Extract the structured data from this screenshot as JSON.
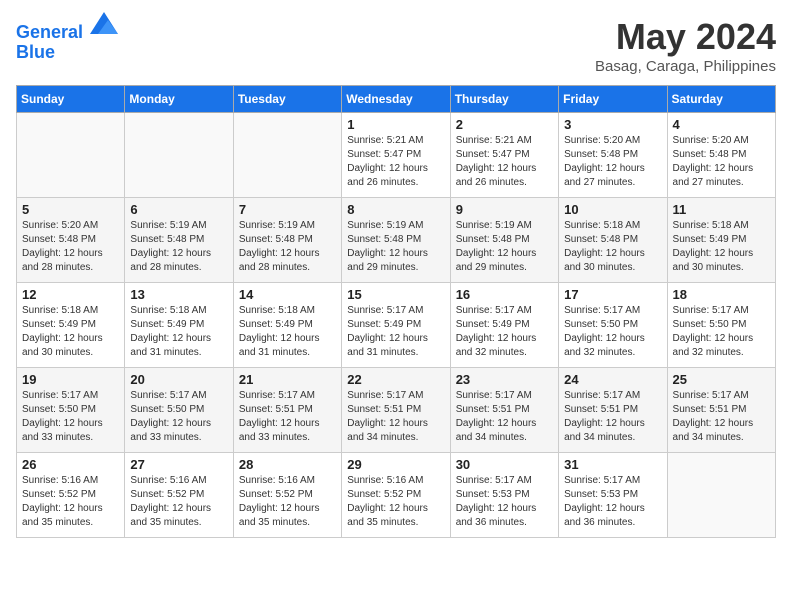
{
  "header": {
    "logo_line1": "General",
    "logo_line2": "Blue",
    "title": "May 2024",
    "subtitle": "Basag, Caraga, Philippines"
  },
  "weekdays": [
    "Sunday",
    "Monday",
    "Tuesday",
    "Wednesday",
    "Thursday",
    "Friday",
    "Saturday"
  ],
  "weeks": [
    [
      {
        "day": "",
        "info": ""
      },
      {
        "day": "",
        "info": ""
      },
      {
        "day": "",
        "info": ""
      },
      {
        "day": "1",
        "info": "Sunrise: 5:21 AM\nSunset: 5:47 PM\nDaylight: 12 hours and 26 minutes."
      },
      {
        "day": "2",
        "info": "Sunrise: 5:21 AM\nSunset: 5:47 PM\nDaylight: 12 hours and 26 minutes."
      },
      {
        "day": "3",
        "info": "Sunrise: 5:20 AM\nSunset: 5:48 PM\nDaylight: 12 hours and 27 minutes."
      },
      {
        "day": "4",
        "info": "Sunrise: 5:20 AM\nSunset: 5:48 PM\nDaylight: 12 hours and 27 minutes."
      }
    ],
    [
      {
        "day": "5",
        "info": "Sunrise: 5:20 AM\nSunset: 5:48 PM\nDaylight: 12 hours and 28 minutes."
      },
      {
        "day": "6",
        "info": "Sunrise: 5:19 AM\nSunset: 5:48 PM\nDaylight: 12 hours and 28 minutes."
      },
      {
        "day": "7",
        "info": "Sunrise: 5:19 AM\nSunset: 5:48 PM\nDaylight: 12 hours and 28 minutes."
      },
      {
        "day": "8",
        "info": "Sunrise: 5:19 AM\nSunset: 5:48 PM\nDaylight: 12 hours and 29 minutes."
      },
      {
        "day": "9",
        "info": "Sunrise: 5:19 AM\nSunset: 5:48 PM\nDaylight: 12 hours and 29 minutes."
      },
      {
        "day": "10",
        "info": "Sunrise: 5:18 AM\nSunset: 5:48 PM\nDaylight: 12 hours and 30 minutes."
      },
      {
        "day": "11",
        "info": "Sunrise: 5:18 AM\nSunset: 5:49 PM\nDaylight: 12 hours and 30 minutes."
      }
    ],
    [
      {
        "day": "12",
        "info": "Sunrise: 5:18 AM\nSunset: 5:49 PM\nDaylight: 12 hours and 30 minutes."
      },
      {
        "day": "13",
        "info": "Sunrise: 5:18 AM\nSunset: 5:49 PM\nDaylight: 12 hours and 31 minutes."
      },
      {
        "day": "14",
        "info": "Sunrise: 5:18 AM\nSunset: 5:49 PM\nDaylight: 12 hours and 31 minutes."
      },
      {
        "day": "15",
        "info": "Sunrise: 5:17 AM\nSunset: 5:49 PM\nDaylight: 12 hours and 31 minutes."
      },
      {
        "day": "16",
        "info": "Sunrise: 5:17 AM\nSunset: 5:49 PM\nDaylight: 12 hours and 32 minutes."
      },
      {
        "day": "17",
        "info": "Sunrise: 5:17 AM\nSunset: 5:50 PM\nDaylight: 12 hours and 32 minutes."
      },
      {
        "day": "18",
        "info": "Sunrise: 5:17 AM\nSunset: 5:50 PM\nDaylight: 12 hours and 32 minutes."
      }
    ],
    [
      {
        "day": "19",
        "info": "Sunrise: 5:17 AM\nSunset: 5:50 PM\nDaylight: 12 hours and 33 minutes."
      },
      {
        "day": "20",
        "info": "Sunrise: 5:17 AM\nSunset: 5:50 PM\nDaylight: 12 hours and 33 minutes."
      },
      {
        "day": "21",
        "info": "Sunrise: 5:17 AM\nSunset: 5:51 PM\nDaylight: 12 hours and 33 minutes."
      },
      {
        "day": "22",
        "info": "Sunrise: 5:17 AM\nSunset: 5:51 PM\nDaylight: 12 hours and 34 minutes."
      },
      {
        "day": "23",
        "info": "Sunrise: 5:17 AM\nSunset: 5:51 PM\nDaylight: 12 hours and 34 minutes."
      },
      {
        "day": "24",
        "info": "Sunrise: 5:17 AM\nSunset: 5:51 PM\nDaylight: 12 hours and 34 minutes."
      },
      {
        "day": "25",
        "info": "Sunrise: 5:17 AM\nSunset: 5:51 PM\nDaylight: 12 hours and 34 minutes."
      }
    ],
    [
      {
        "day": "26",
        "info": "Sunrise: 5:16 AM\nSunset: 5:52 PM\nDaylight: 12 hours and 35 minutes."
      },
      {
        "day": "27",
        "info": "Sunrise: 5:16 AM\nSunset: 5:52 PM\nDaylight: 12 hours and 35 minutes."
      },
      {
        "day": "28",
        "info": "Sunrise: 5:16 AM\nSunset: 5:52 PM\nDaylight: 12 hours and 35 minutes."
      },
      {
        "day": "29",
        "info": "Sunrise: 5:16 AM\nSunset: 5:52 PM\nDaylight: 12 hours and 35 minutes."
      },
      {
        "day": "30",
        "info": "Sunrise: 5:17 AM\nSunset: 5:53 PM\nDaylight: 12 hours and 36 minutes."
      },
      {
        "day": "31",
        "info": "Sunrise: 5:17 AM\nSunset: 5:53 PM\nDaylight: 12 hours and 36 minutes."
      },
      {
        "day": "",
        "info": ""
      }
    ]
  ]
}
